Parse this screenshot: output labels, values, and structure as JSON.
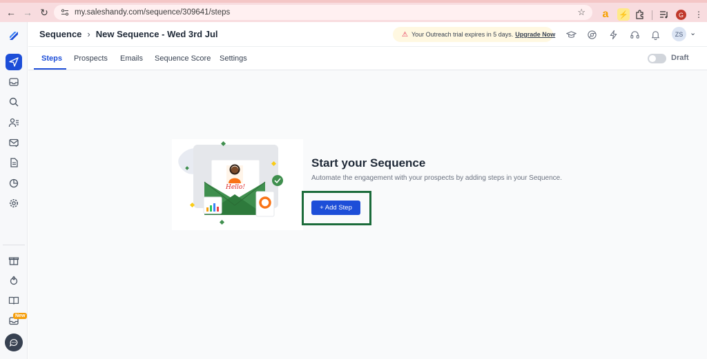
{
  "browser": {
    "url": "my.saleshandy.com/sequence/309641/steps",
    "profile_initial": "G"
  },
  "rail": {
    "items": [
      "logo",
      "sequences",
      "inbox",
      "search",
      "prospects",
      "email-accounts",
      "templates",
      "reports",
      "settings",
      "gift",
      "rewards",
      "docs",
      "whats-new",
      "chat"
    ],
    "new_badge": "New"
  },
  "header": {
    "breadcrumb_root": "Sequence",
    "breadcrumb_current": "New Sequence - Wed 3rd Jul",
    "trial_text": "Your Outreach trial expires in 5 days.",
    "trial_link": "Upgrade Now",
    "user_initials": "ZS"
  },
  "tabs": {
    "items": [
      {
        "label": "Steps",
        "active": true
      },
      {
        "label": "Prospects",
        "active": false
      },
      {
        "label": "Emails",
        "active": false
      },
      {
        "label": "Sequence Score",
        "active": false
      },
      {
        "label": "Settings",
        "active": false
      }
    ],
    "status_label": "Draft",
    "status_on": false
  },
  "empty_state": {
    "title": "Start your Sequence",
    "description": "Automate the engagement with your prospects by adding steps in your Sequence.",
    "button_label": "+ Add Step",
    "illustration_greeting": "Hello!"
  },
  "colors": {
    "primary": "#1d4ed8",
    "highlight": "#1b6b3a",
    "trial_bg": "#fff8e1",
    "browser_bar": "#f8dcdf"
  }
}
